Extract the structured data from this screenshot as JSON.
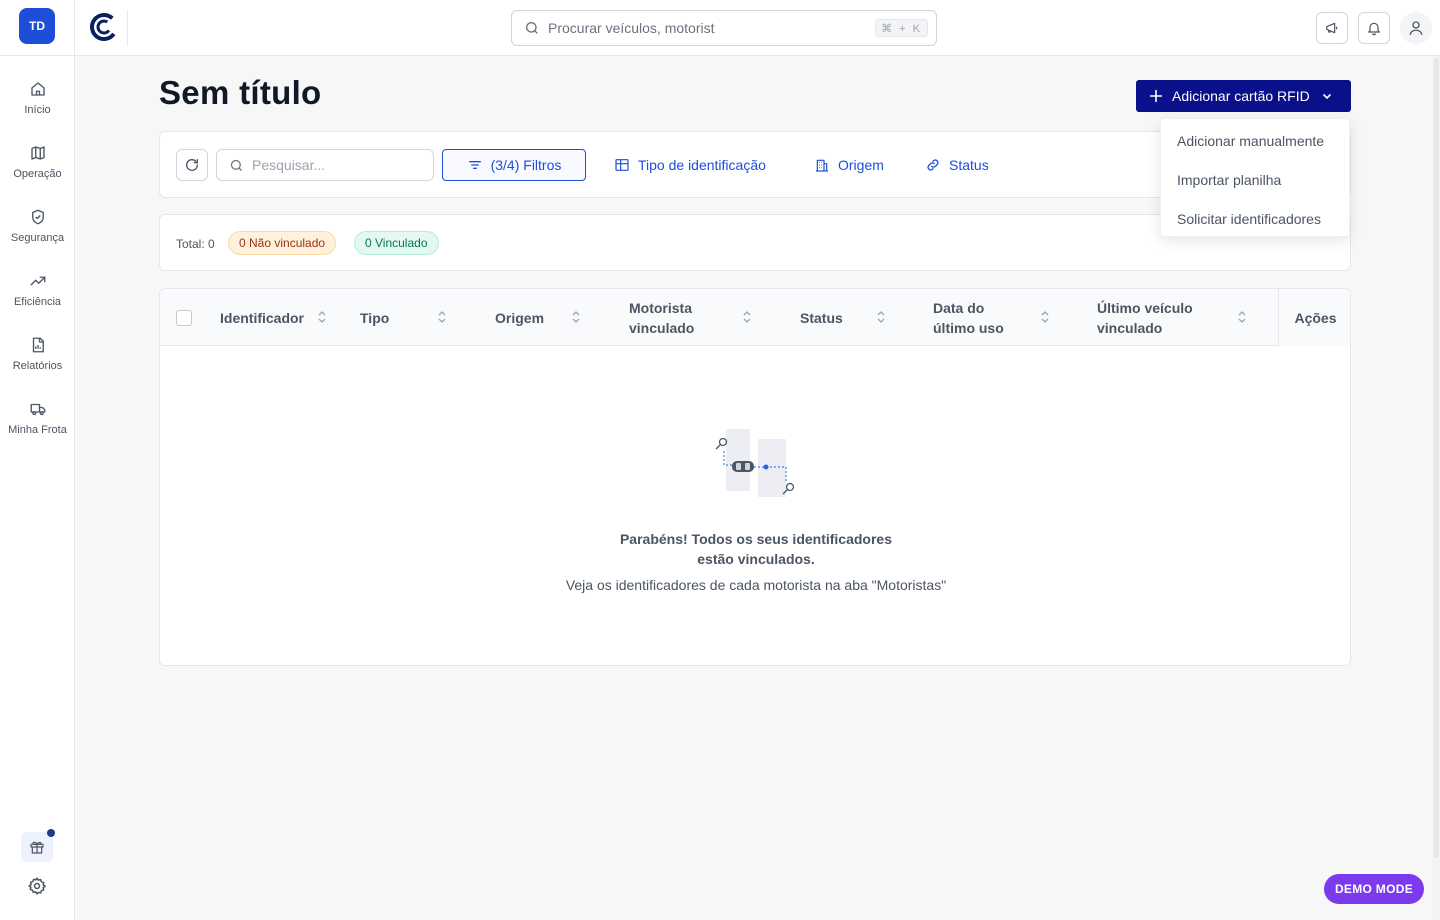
{
  "sidebar": {
    "avatar_initials": "TD",
    "items": [
      {
        "label": "Início",
        "icon": "home-icon"
      },
      {
        "label": "Operação",
        "icon": "map-icon"
      },
      {
        "label": "Segurança",
        "icon": "shield-check-icon"
      },
      {
        "label": "Eficiência",
        "icon": "trending-up-icon"
      },
      {
        "label": "Relatórios",
        "icon": "file-report-icon"
      },
      {
        "label": "Minha Frota",
        "icon": "truck-icon"
      }
    ]
  },
  "topbar": {
    "search_placeholder": "Procurar veículos, motorist",
    "shortcut": "⌘ + K"
  },
  "page": {
    "title": "Sem título",
    "add_button_label": "Adicionar cartão RFID"
  },
  "add_menu": {
    "items": [
      "Adicionar manualmente",
      "Importar planilha",
      "Solicitar identificadores"
    ]
  },
  "filters": {
    "search_placeholder": "Pesquisar...",
    "filters_label": "(3/4) Filtros",
    "id_type_label": "Tipo de identificação",
    "origin_label": "Origem",
    "status_label": "Status"
  },
  "totals": {
    "total_label": "Total: 0",
    "unlinked_label": "0 Não vinculado",
    "linked_label": "0 Vinculado"
  },
  "table": {
    "columns": {
      "identifier": "Identificador",
      "type": "Tipo",
      "origin": "Origem",
      "driver_line1": "Motorista",
      "driver_line2": "vinculado",
      "status": "Status",
      "last_use_line1": "Data do",
      "last_use_line2": "último uso",
      "last_vehicle_line1": "Último veículo",
      "last_vehicle_line2": "vinculado",
      "actions": "Ações"
    },
    "empty_title_line1": "Parabéns! Todos os seus identificadores",
    "empty_title_line2": "estão vinculados.",
    "empty_subtitle": "Veja os identificadores de cada motorista na aba \"Motoristas\""
  },
  "demo_badge": "DEMO MODE",
  "colors": {
    "primary": "#0a0f8a",
    "link": "#1d4ed8",
    "avatar": "#1d4ed8",
    "demo": "#7c3aed"
  }
}
